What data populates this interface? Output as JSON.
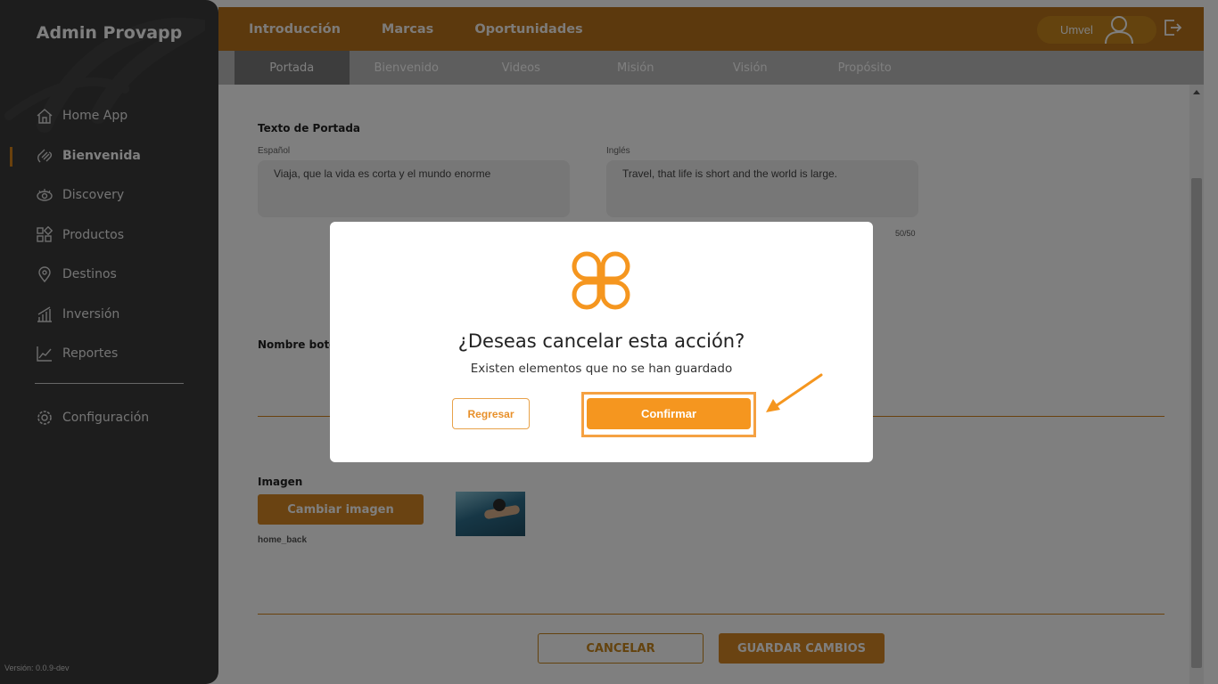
{
  "sidebar": {
    "brand": "Admin Provapp",
    "items": [
      {
        "label": "Home App",
        "icon": "home-icon"
      },
      {
        "label": "Bienvenida",
        "icon": "wave-hand-icon",
        "active": true
      },
      {
        "label": "Discovery",
        "icon": "eye-icon"
      },
      {
        "label": "Productos",
        "icon": "grid-icon"
      },
      {
        "label": "Destinos",
        "icon": "location-pin-icon"
      },
      {
        "label": "Inversión",
        "icon": "bar-chart-icon"
      },
      {
        "label": "Reportes",
        "icon": "line-chart-icon"
      }
    ],
    "config": {
      "label": "Configuración",
      "icon": "gear-icon"
    },
    "version": "Versión: 0.0.9-dev"
  },
  "topbar": {
    "tabs": [
      "Introducción",
      "Marcas",
      "Oportunidades"
    ],
    "active_tab": "Introducción",
    "user": "Umvel"
  },
  "subtabs": {
    "items": [
      "Portada",
      "Bienvenido",
      "Videos",
      "Misión",
      "Visión",
      "Propósito"
    ],
    "active": "Portada"
  },
  "form": {
    "cover_title": "Texto de Portada",
    "spanish_label": "Español",
    "spanish_value": "Viaja, que la vida es corta y el mundo enorme",
    "english_label": "Inglés",
    "english_value": "Travel, that life is short and the world is large.",
    "counter": "50/50",
    "button_name_title": "Nombre botón",
    "image_title": "Imagen",
    "change_image_label": "Cambiar imagen",
    "image_filename": "home_back",
    "cancel_label": "CANCELAR",
    "save_label": "GUARDAR CAMBIOS"
  },
  "modal": {
    "title": "¿Deseas cancelar esta acción?",
    "subtitle": "Existen elementos que no se han guardado",
    "back_label": "Regresar",
    "confirm_label": "Confirmar"
  },
  "colors": {
    "accent": "#f5961f",
    "topbar": "#b8721a",
    "sidebar": "#3a3a3a"
  }
}
